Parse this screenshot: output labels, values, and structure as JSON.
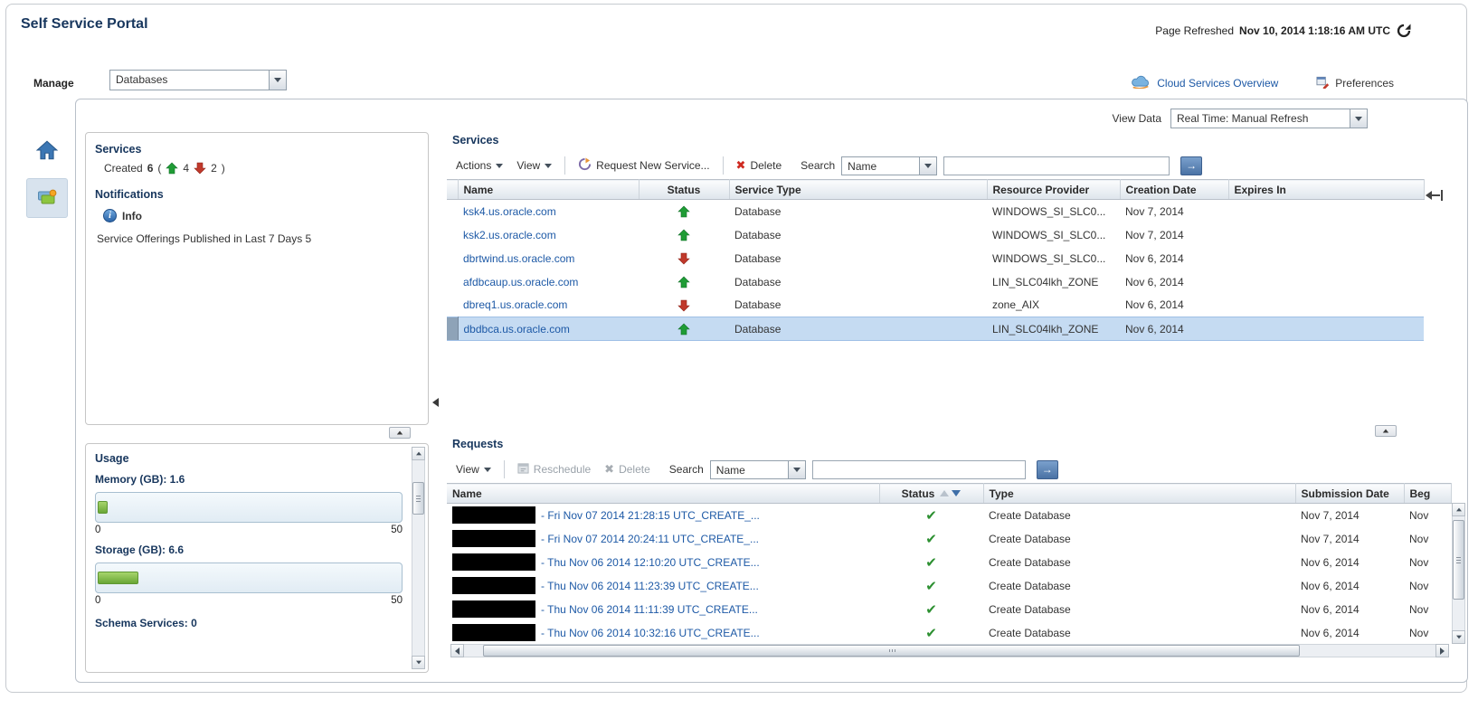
{
  "header": {
    "title": "Self Service Portal",
    "page_refreshed_label": "Page Refreshed",
    "page_refreshed_value": "Nov 10, 2014 1:18:16 AM UTC"
  },
  "manage_bar": {
    "label": "Manage",
    "selected": "Databases",
    "cloud_services_overview": "Cloud Services Overview",
    "preferences": "Preferences"
  },
  "view_data_bar": {
    "label": "View Data",
    "value": "Real Time: Manual Refresh"
  },
  "summary": {
    "title": "Services",
    "created_label": "Created",
    "created_value": "6",
    "open_paren": "(",
    "up_count": "4",
    "down_count": "2",
    "close_paren": ")",
    "notifications_title": "Notifications",
    "info_label": "Info",
    "notification_text": "Service Offerings Published in Last 7 Days 5"
  },
  "services": {
    "title": "Services",
    "toolbar": {
      "actions_label": "Actions",
      "view_label": "View",
      "request_new_service_label": "Request New Service...",
      "delete_label": "Delete",
      "search_label": "Search",
      "search_category": "Name",
      "search_value": ""
    },
    "columns": [
      "Name",
      "Status",
      "Service Type",
      "Resource Provider",
      "Creation Date",
      "Expires In"
    ],
    "rows": [
      {
        "name": "ksk4.us.oracle.com",
        "status": "up",
        "type": "Database",
        "provider": "WINDOWS_SI_SLC0...",
        "created": "Nov 7, 2014",
        "expires": ""
      },
      {
        "name": "ksk2.us.oracle.com",
        "status": "up",
        "type": "Database",
        "provider": "WINDOWS_SI_SLC0...",
        "created": "Nov 7, 2014",
        "expires": ""
      },
      {
        "name": "dbrtwind.us.oracle.com",
        "status": "down",
        "type": "Database",
        "provider": "WINDOWS_SI_SLC0...",
        "created": "Nov 6, 2014",
        "expires": ""
      },
      {
        "name": "afdbcaup.us.oracle.com",
        "status": "up",
        "type": "Database",
        "provider": "LIN_SLC04lkh_ZONE",
        "created": "Nov 6, 2014",
        "expires": ""
      },
      {
        "name": "dbreq1.us.oracle.com",
        "status": "down",
        "type": "Database",
        "provider": "zone_AIX",
        "created": "Nov 6, 2014",
        "expires": ""
      },
      {
        "name": "dbdbca.us.oracle.com",
        "status": "up",
        "type": "Database",
        "provider": "LIN_SLC04lkh_ZONE",
        "created": "Nov 6, 2014",
        "expires": "",
        "selected": "true"
      }
    ]
  },
  "usage": {
    "title": "Usage",
    "metrics": [
      {
        "label": "Memory (GB): 1.6",
        "min": "0",
        "max": "50",
        "fill_percent": 3.2
      },
      {
        "label": "Storage (GB): 6.6",
        "min": "0",
        "max": "50",
        "fill_percent": 13.2
      }
    ],
    "schema_services_label": "Schema Services: 0"
  },
  "requests": {
    "title": "Requests",
    "toolbar": {
      "view_label": "View",
      "reschedule_label": "Reschedule",
      "delete_label": "Delete",
      "search_label": "Search",
      "search_category": "Name",
      "search_value": ""
    },
    "columns": [
      "Name",
      "Status",
      "Type",
      "Submission Date",
      "Beg"
    ],
    "sort": {
      "column": "Status",
      "direction": "descending"
    },
    "rows": [
      {
        "name": "- Fri Nov 07 2014 21:28:15 UTC_CREATE_...",
        "status": "success",
        "type": "Create Database",
        "submitted": "Nov 7, 2014",
        "begin": "Nov"
      },
      {
        "name": "- Fri Nov 07 2014 20:24:11 UTC_CREATE_...",
        "status": "success",
        "type": "Create Database",
        "submitted": "Nov 7, 2014",
        "begin": "Nov"
      },
      {
        "name": "- Thu Nov 06 2014 12:10:20 UTC_CREATE...",
        "status": "success",
        "type": "Create Database",
        "submitted": "Nov 6, 2014",
        "begin": "Nov"
      },
      {
        "name": "- Thu Nov 06 2014 11:23:39 UTC_CREATE...",
        "status": "success",
        "type": "Create Database",
        "submitted": "Nov 6, 2014",
        "begin": "Nov"
      },
      {
        "name": "- Thu Nov 06 2014 11:11:39 UTC_CREATE...",
        "status": "success",
        "type": "Create Database",
        "submitted": "Nov 6, 2014",
        "begin": "Nov"
      },
      {
        "name": "- Thu Nov 06 2014 10:32:16 UTC_CREATE...",
        "status": "success",
        "type": "Create Database",
        "submitted": "Nov 6, 2014",
        "begin": "Nov"
      }
    ]
  },
  "icons": {
    "delete_x": "✖",
    "check": "✔",
    "go_arrow": "→"
  },
  "colors": {
    "up_green": "#1f9c35",
    "down_red": "#c0392b",
    "check_green": "#2d9031",
    "link_blue": "#1d59a6",
    "selected_row": "#c5dbf2",
    "title_navy": "#17365d"
  }
}
